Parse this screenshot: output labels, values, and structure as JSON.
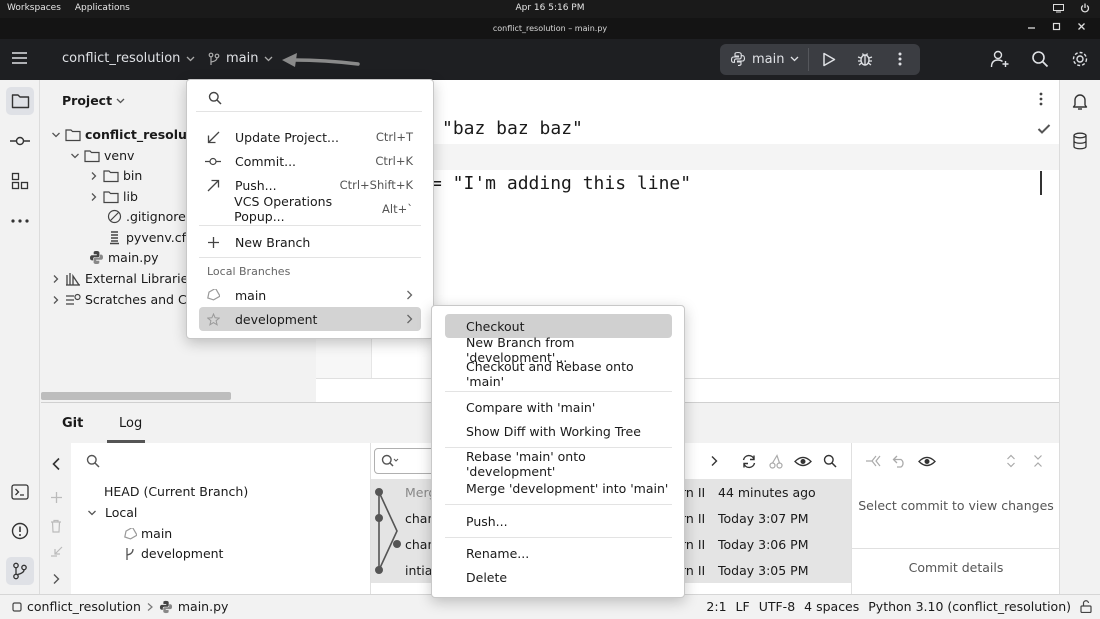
{
  "os_bar": {
    "workspaces": "Workspaces",
    "applications": "Applications",
    "clock": "Apr 16   5:16 PM"
  },
  "window": {
    "title": "conflict_resolution – main.py"
  },
  "toolbar": {
    "project": "conflict_resolution",
    "branch": "main",
    "run_config": "main"
  },
  "project_panel": {
    "title": "Project",
    "tree": [
      {
        "label": "conflict_resolution",
        "icon": "folder-icon",
        "bold": true
      },
      {
        "label": "venv",
        "icon": "folder-icon"
      },
      {
        "label": "bin",
        "icon": "folder-icon"
      },
      {
        "label": "lib",
        "icon": "folder-icon"
      },
      {
        "label": ".gitignore",
        "icon": "ignore-file-icon"
      },
      {
        "label": "pyvenv.cfg",
        "icon": "config-file-icon"
      },
      {
        "label": "main.py",
        "icon": "python-icon"
      },
      {
        "label": "External Libraries",
        "icon": "library-icon"
      },
      {
        "label": "Scratches and Consoles",
        "icon": "scratches-icon"
      }
    ]
  },
  "editor": {
    "lines": [
      "\"baz baz baz\"",
      "= \"I'm adding this line\""
    ]
  },
  "branch_popup": {
    "search_placeholder": "",
    "actions": [
      {
        "label": "Update Project...",
        "shortcut": "Ctrl+T",
        "icon": "update-arrow-icon"
      },
      {
        "label": "Commit...",
        "shortcut": "Ctrl+K",
        "icon": "commit-icon"
      },
      {
        "label": "Push...",
        "shortcut": "Ctrl+Shift+K",
        "icon": "push-arrow-icon"
      },
      {
        "label": "VCS Operations Popup...",
        "shortcut": "Alt+`",
        "icon": ""
      },
      {
        "label": "New Branch",
        "shortcut": "",
        "icon": "plus-icon"
      }
    ],
    "local_branches_header": "Local Branches",
    "branches": [
      {
        "label": "main",
        "icon": "tag-icon"
      },
      {
        "label": "development",
        "icon": "star-icon"
      }
    ]
  },
  "branch_submenu": {
    "items": [
      "Checkout",
      "New Branch from 'development'...",
      "Checkout and Rebase onto 'main'",
      "Compare with 'main'",
      "Show Diff with Working Tree",
      "Rebase 'main' onto 'development'",
      "Merge 'development' into 'main'",
      "Push...",
      "Rename...",
      "Delete"
    ],
    "selected": "Checkout"
  },
  "git_panel": {
    "tabs": [
      "Git",
      "Log"
    ],
    "branches_tree": {
      "head": "HEAD (Current Branch)",
      "local": "Local",
      "branches": [
        "main",
        "development"
      ]
    },
    "log": [
      {
        "message": "Merg",
        "author": "rn II",
        "date": "44 minutes ago"
      },
      {
        "message": "chan",
        "author": "rn II",
        "date": "Today 3:07 PM"
      },
      {
        "message": "chan",
        "author": "rn II",
        "date": "Today 3:06 PM"
      },
      {
        "message": "intia",
        "author": "rn II",
        "date": "Today 3:05 PM"
      }
    ],
    "details_placeholder": "Select commit to view changes",
    "commit_details_label": "Commit details"
  },
  "status_bar": {
    "breadcrumb": [
      "conflict_resolution",
      "main.py"
    ],
    "position": "2:1",
    "line_sep": "LF",
    "encoding": "UTF-8",
    "indent": "4 spaces",
    "interpreter": "Python 3.10 (conflict_resolution)"
  }
}
